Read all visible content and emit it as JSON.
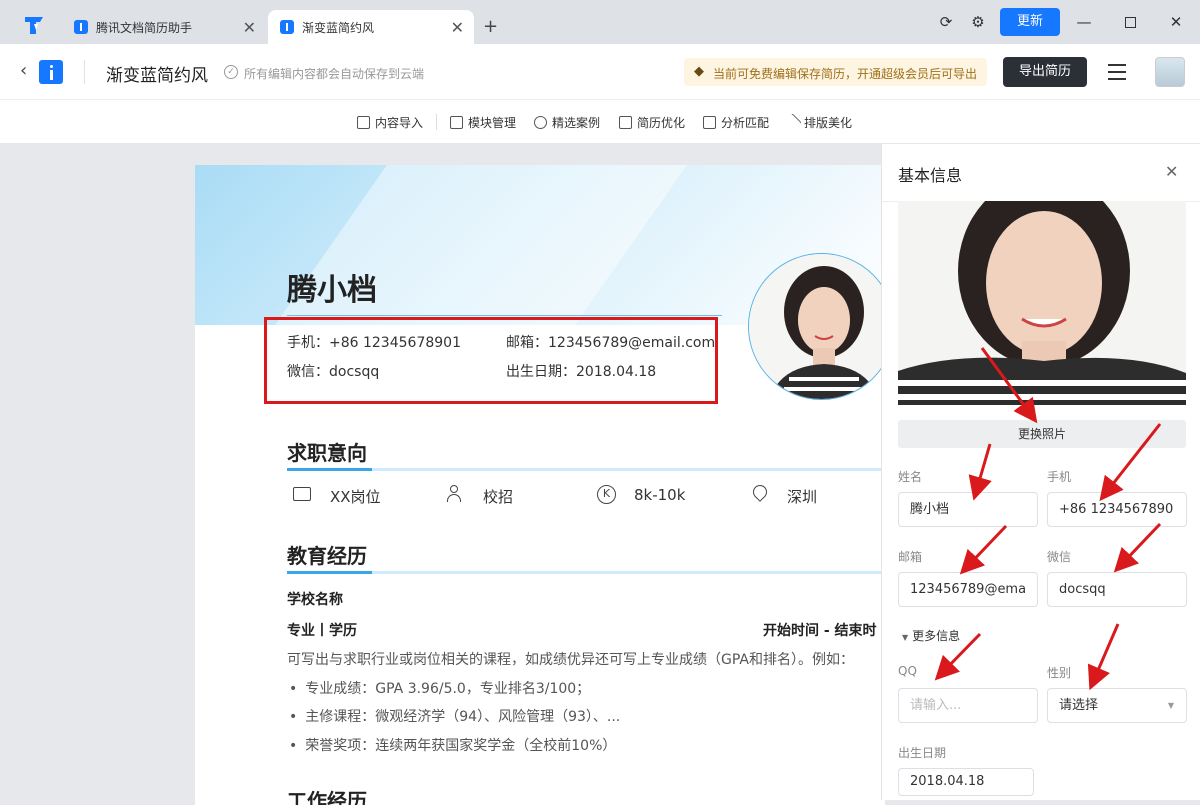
{
  "tabs": [
    {
      "label": "腾讯文档简历助手"
    },
    {
      "label": "渐变蓝简约风"
    }
  ],
  "titlebar": {
    "update_label": "更新"
  },
  "header": {
    "doc_title": "渐变蓝简约风",
    "save_status": "所有编辑内容都会自动保存到云端",
    "notice": "当前可免费编辑保存简历，开通超级会员后可导出",
    "export_label": "导出简历"
  },
  "toolbar": {
    "items": [
      {
        "label": "内容导入"
      },
      {
        "label": "模块管理"
      },
      {
        "label": "精选案例"
      },
      {
        "label": "简历优化"
      },
      {
        "label": "分析匹配"
      },
      {
        "label": "排版美化"
      }
    ]
  },
  "resume": {
    "name": "腾小档",
    "phone": "手机：+86 12345678901",
    "email": "邮箱：123456789@email.com",
    "wechat": "微信：docsqq",
    "birth": "出生日期：2018.04.18",
    "intent_title": "求职意向",
    "intent": {
      "position": "XX岗位",
      "type": "校招",
      "salary": "8k-10k",
      "city": "深圳"
    },
    "edu_title": "教育经历",
    "school": "学校名称",
    "major": "专业丨学历",
    "period": "开始时间 - 结束时",
    "desc": "可写出与求职行业或岗位相关的课程，如成绩优异还可写上专业成绩（GPA和排名）。例如：",
    "bullets": [
      "专业成绩：GPA 3.96/5.0，专业排名3/100；",
      "主修课程：微观经济学（94）、风险管理（93）、...",
      "荣誉奖项：连续两年获国家奖学金（全校前10%）"
    ],
    "work_title": "工作经历"
  },
  "panel": {
    "title": "基本信息",
    "change_photo": "更换照片",
    "name_label": "姓名",
    "name_value": "腾小档",
    "phone_label": "手机",
    "phone_value": "+86 1234567890",
    "email_label": "邮箱",
    "email_value": "123456789@ema",
    "wechat_label": "微信",
    "wechat_value": "docsqq",
    "more_label": "更多信息",
    "qq_label": "QQ",
    "qq_placeholder": "请输入...",
    "gender_label": "性别",
    "gender_value": "请选择",
    "birth_label": "出生日期",
    "birth_value": "2018.04.18"
  },
  "colors": {
    "accent": "#1677ff",
    "annotation_red": "#d9191c",
    "export_btn": "#2b2f36"
  }
}
